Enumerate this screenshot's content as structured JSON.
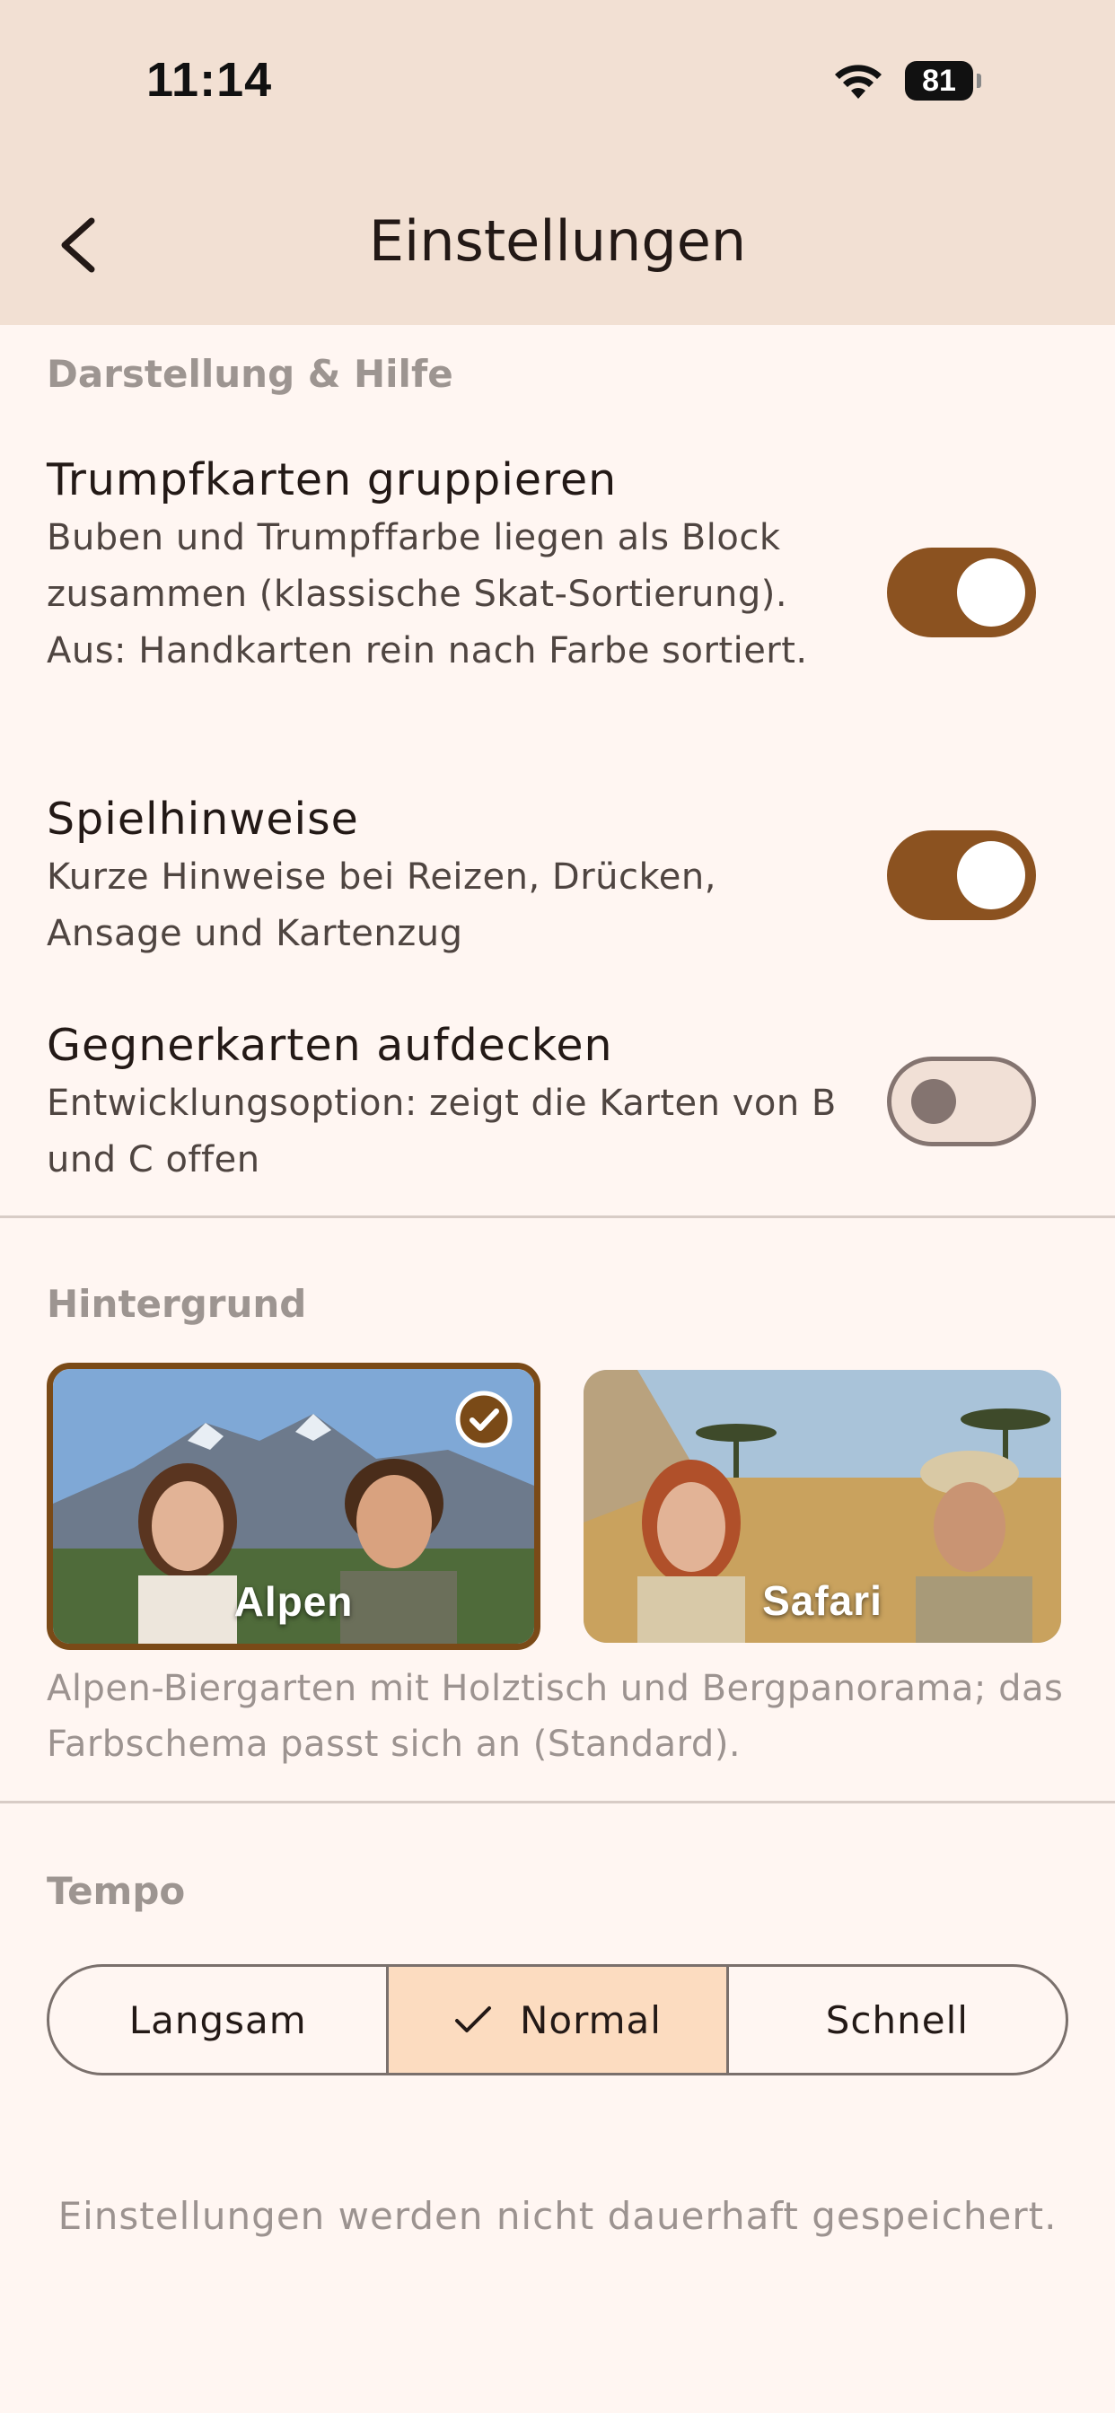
{
  "status_bar": {
    "time": "11:14",
    "battery": "81"
  },
  "header": {
    "title": "Einstellungen"
  },
  "sections": {
    "display": {
      "label": "Darstellung & Hilfe",
      "settings": [
        {
          "title": "Trumpfkarten gruppieren",
          "description": "Buben und Trumpffarbe liegen als Block zusammen (klassische Skat-Sortierung). Aus: Handkarten rein nach Farbe sortiert.",
          "enabled": true
        },
        {
          "title": "Spielhinweise",
          "description": "Kurze Hinweise bei Reizen, Drücken, Ansage und Kartenzug",
          "enabled": true
        },
        {
          "title": "Gegnerkarten aufdecken",
          "description": "Entwicklungsoption: zeigt die Karten von B und C offen",
          "enabled": false
        }
      ]
    },
    "background": {
      "label": "Hintergrund",
      "options": [
        {
          "label": "Alpen",
          "selected": true
        },
        {
          "label": "Safari",
          "selected": false
        }
      ],
      "description": "Alpen-Biergarten mit Holztisch und Bergpanorama; das Farbschema passt sich an (Standard)."
    },
    "tempo": {
      "label": "Tempo",
      "options": [
        {
          "label": "Langsam",
          "selected": false
        },
        {
          "label": "Normal",
          "selected": true
        },
        {
          "label": "Schnell",
          "selected": false
        }
      ]
    }
  },
  "footer": {
    "note": "Einstellungen werden nicht dauerhaft gespeichert."
  },
  "colors": {
    "accent": "#8B5220",
    "background": "#FFF6F2",
    "header": "#F2E0D3",
    "segment_active": "#FCDCC0"
  }
}
